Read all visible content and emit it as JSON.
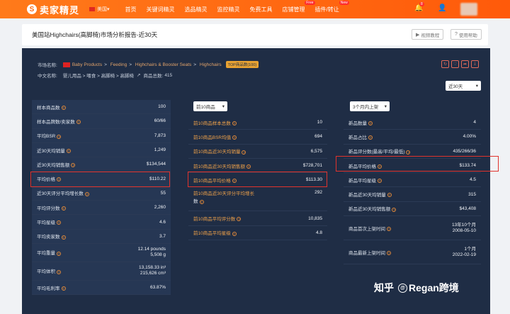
{
  "nav": {
    "logo_mark": "S",
    "logo_text": "卖家精灵",
    "region": "美国",
    "items": [
      "首页",
      "关键词精灵",
      "选品精灵",
      "监控精灵",
      "免费工具",
      "店铺管理",
      "插件/转让"
    ],
    "free_badge": "Free",
    "new_badge": "New",
    "bell_count": "8"
  },
  "report": {
    "title": "美国站Highchairs(高脚椅)市场分析报告-近30天",
    "btn_tutorial": "视频教程",
    "btn_help": "使用帮助"
  },
  "meta": {
    "market_label": "市场名称:",
    "breadcrumb": [
      "Baby Products",
      "Feeding",
      "Highchairs & Booster Seats",
      "Highchairs"
    ],
    "sep": ">",
    "top_badge": "TOP商品数(100)",
    "cn_label": "中文名称:",
    "cn_name": "婴儿用品 > 喂食 > 高脚椅 > 高脚椅",
    "total_label": "商品总数:",
    "total_value": "415",
    "period": "近30天"
  },
  "col1": [
    {
      "label": "样本商品数",
      "value": "100"
    },
    {
      "label": "样本品牌数/卖家数",
      "value": "60/66"
    },
    {
      "label": "平均BSR",
      "value": "7,873"
    },
    {
      "label": "近30天均销量",
      "value": "1,249"
    },
    {
      "label": "近30天均销售额",
      "value": "$134,544"
    },
    {
      "label": "平均价格",
      "value": "$110.22"
    },
    {
      "label": "近30天评分平均增长数",
      "value": "55"
    },
    {
      "label": "平均评分数",
      "value": "2,260"
    },
    {
      "label": "平均星级",
      "value": "4.6"
    },
    {
      "label": "平均卖家数",
      "value": "3.7"
    },
    {
      "label": "平均重量",
      "value": "12.14 pounds",
      "value2": "5,508 g"
    },
    {
      "label": "平均体积",
      "value": "13,158.33 in³",
      "value2": "215,626 cm³"
    },
    {
      "label": "平均毛利率",
      "value": "63.87%"
    }
  ],
  "col2": {
    "select": "前10商品",
    "rows": [
      {
        "label": "前10商品样本总数",
        "value": "10"
      },
      {
        "label": "前10商品BSR均值",
        "value": "694"
      },
      {
        "label": "前10商品近30天均销量",
        "value": "6,575"
      },
      {
        "label": "前10商品近30天均销售额",
        "value": "$728,701"
      },
      {
        "label": "前10商品平均价格",
        "value": "$113.30"
      },
      {
        "label": "前10商品近30天评分平均增长",
        "label2": "数",
        "value": "292"
      },
      {
        "label": "前10商品平均评分数",
        "value": "10,835"
      },
      {
        "label": "前10商品平均星级",
        "value": "4.8"
      }
    ]
  },
  "col3": {
    "select": "3个月内上架",
    "rows": [
      {
        "label": "新品数量",
        "value": "4"
      },
      {
        "label": "新品占比",
        "value": "4.00%"
      },
      {
        "label": "新品评分数(最高/平均/最低)",
        "value": "435/266/36"
      },
      {
        "label": "新品平均价格",
        "value": "$133.74"
      },
      {
        "label": "新品平均星级",
        "value": "4.5"
      },
      {
        "label": "新品近30天均销量",
        "value": "315"
      },
      {
        "label": "新品近30天均销售额",
        "value": "$43,408"
      },
      {
        "label": "商品首次上架时间",
        "value": "13年10个月",
        "value2": "2008-05-10"
      },
      {
        "label": "商品最新上架时间",
        "value": "1个月",
        "value2": "2022-02-19"
      }
    ]
  },
  "watermark": {
    "zhihu": "知乎",
    "author": "Regan跨境",
    "circle": "@"
  },
  "colors": {
    "nav_orange": "#ff6a10",
    "panel_navy": "#1f2d45",
    "highlight_red": "#e0332d",
    "label_orange": "#f0a24a"
  }
}
